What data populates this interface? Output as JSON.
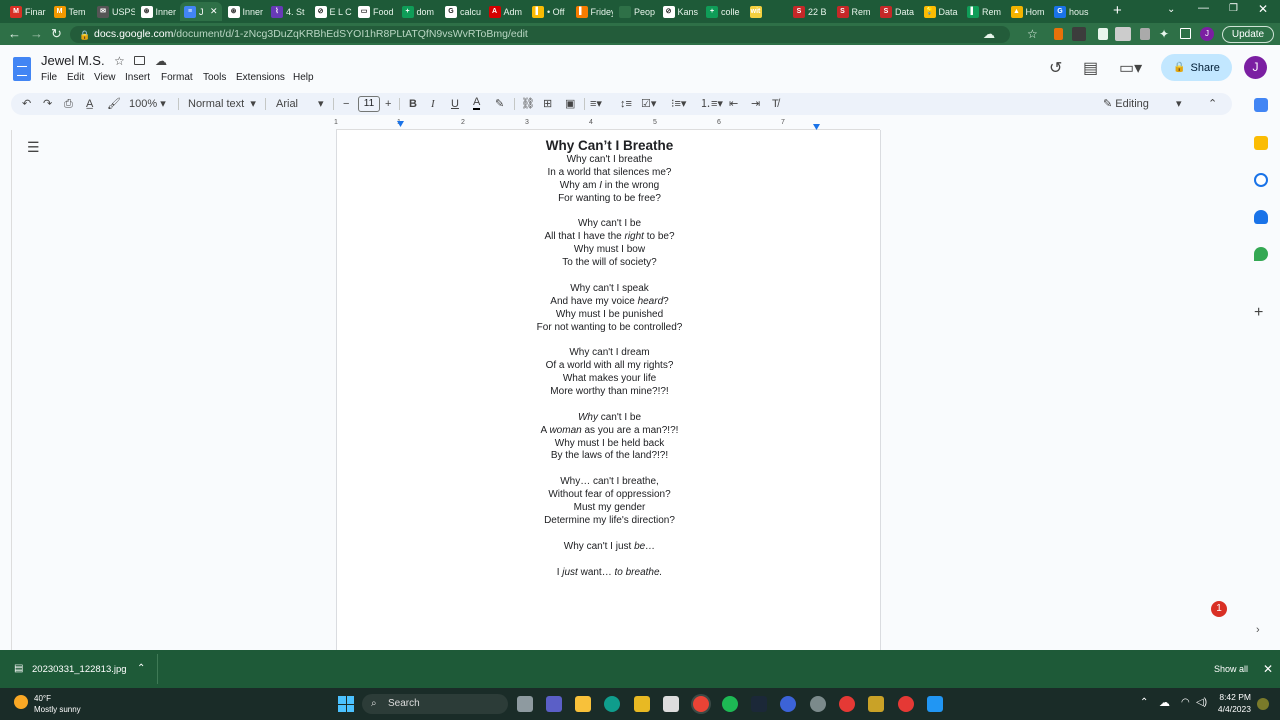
{
  "browser": {
    "tabs": [
      {
        "label": "Finar",
        "color": "#d93025",
        "letter": "M"
      },
      {
        "label": "Tem",
        "color": "#f29900",
        "letter": "M"
      },
      {
        "label": "USPS",
        "color": "#555555",
        "letter": "✉"
      },
      {
        "label": "Inner",
        "color": "#ffffff",
        "letter": "⊛"
      },
      {
        "label": "J",
        "color": "#4285f4",
        "letter": "≡"
      },
      {
        "label": "Inner",
        "color": "#ffffff",
        "letter": "⊛"
      },
      {
        "label": "4. St",
        "color": "#673ab7",
        "letter": "⌇"
      },
      {
        "label": "E L C",
        "color": "#ffffff",
        "letter": "⊘"
      },
      {
        "label": "Food",
        "color": "#ffffff",
        "letter": "▭"
      },
      {
        "label": "dom",
        "color": "#0f9d58",
        "letter": "+"
      },
      {
        "label": "calcu",
        "color": "#ffffff",
        "letter": "G"
      },
      {
        "label": "Adm",
        "color": "#d50000",
        "letter": "A"
      },
      {
        "label": "• Off",
        "color": "#fbbc04",
        "letter": "▌"
      },
      {
        "label": "Fridey",
        "color": "#f57c00",
        "letter": "▌"
      },
      {
        "label": "Peop",
        "color": "#2e7047",
        "letter": " "
      },
      {
        "label": "Kans",
        "color": "#ffffff",
        "letter": "⊘"
      },
      {
        "label": "colle",
        "color": "#0f9d58",
        "letter": "+"
      },
      {
        "label": "",
        "color": "#f4d03f",
        "letter": "wit"
      },
      {
        "label": "22 B",
        "color": "#c62828",
        "letter": "S"
      },
      {
        "label": "Rem",
        "color": "#c62828",
        "letter": "S"
      },
      {
        "label": "Data",
        "color": "#c62828",
        "letter": "S"
      },
      {
        "label": "Data",
        "color": "#fbbc04",
        "letter": "💡"
      },
      {
        "label": "Rem",
        "color": "#0f9d58",
        "letter": "▌"
      },
      {
        "label": "Hom",
        "color": "#f4b400",
        "letter": "▲"
      },
      {
        "label": "hous",
        "color": "#1a73e8",
        "letter": "G"
      }
    ],
    "active_tab_index": 4,
    "new_tab_label": "+",
    "url_host": "docs.google.com",
    "url_path": "/document/d/1-zNcg3DuZqKRBhEdSYOI1hR8PLtATQfN9vsWvRToBmg/edit",
    "update_label": "Update"
  },
  "docs": {
    "title": "Jewel M.S.",
    "menu": [
      "File",
      "Edit",
      "View",
      "Insert",
      "Format",
      "Tools",
      "Extensions",
      "Help"
    ],
    "share_label": "Share",
    "account_initial": "J",
    "toolbar": {
      "zoom": "100%",
      "style": "Normal text",
      "font": "Arial",
      "font_size": "11",
      "mode": "Editing"
    },
    "ruler_numbers": [
      "1",
      "1",
      "2",
      "3",
      "4",
      "5",
      "6",
      "7"
    ]
  },
  "poem": {
    "title": "Why Can’t I Breathe",
    "lines": [
      [
        "Why can't I breathe"
      ],
      [
        "In a world that silences me?"
      ],
      [
        "Why am ",
        {
          "i": "I"
        },
        " in the wrong"
      ],
      [
        "For wanting to be free?"
      ],
      null,
      [
        "Why can't I be"
      ],
      [
        "All that I have the ",
        {
          "i": "right"
        },
        " to be?"
      ],
      [
        "Why must I bow"
      ],
      [
        "To the will of society?"
      ],
      null,
      [
        "Why can't I speak"
      ],
      [
        "And have my voice ",
        {
          "i": "heard"
        },
        "?"
      ],
      [
        "Why must I be punished"
      ],
      [
        "For not wanting to be controlled?"
      ],
      null,
      [
        "Why can't I dream"
      ],
      [
        "Of a world with all my rights?"
      ],
      [
        "What makes your life"
      ],
      [
        "More worthy than mine?!?!"
      ],
      null,
      [
        {
          "i": "Why"
        },
        " can't I be"
      ],
      [
        "A ",
        {
          "i": "woman"
        },
        " as you are a man?!?!"
      ],
      [
        "Why must I be held back"
      ],
      [
        "By the laws of the land?!?!"
      ],
      null,
      [
        "Why… can't I breathe,"
      ],
      [
        "Without fear of oppression?"
      ],
      [
        "Must my gender"
      ],
      [
        "Determine my life's direction?"
      ],
      null,
      [
        "Why can't I just ",
        {
          "i": "be"
        },
        {
          "i": "…"
        }
      ],
      null,
      [
        "I ",
        {
          "i": "just"
        },
        " want… ",
        {
          "i": "to breathe."
        }
      ]
    ]
  },
  "downloads": {
    "file_name": "20230331_122813.jpg",
    "show_all_label": "Show all"
  },
  "taskbar": {
    "weather_temp": "40°F",
    "weather_desc": "Mostly sunny",
    "search_placeholder": "Search",
    "time": "8:42 PM",
    "date": "4/4/2023",
    "notification_count": "1"
  },
  "colors": {
    "chrome_green": "#1e5a38",
    "docs_blue": "#4285f4",
    "share_bg": "#c2e7ff"
  }
}
